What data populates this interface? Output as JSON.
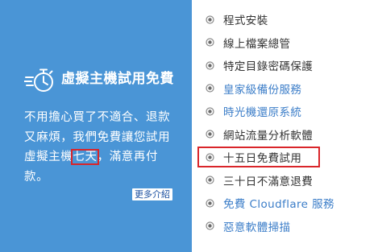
{
  "promo": {
    "title": "虛擬主機試用免費",
    "desc_before": "不用擔心買了不適合、退款又麻煩，我們免費讓您試用虛擬主機",
    "desc_highlight": "七天",
    "desc_after": "，滿意再付款。",
    "more_label": "更多介紹",
    "icon": "stopwatch-icon",
    "highlight_color": "#d9252a",
    "background_color": "#4a95d6"
  },
  "features": {
    "items": [
      {
        "label": "程式安裝",
        "link": false
      },
      {
        "label": "線上檔案總管",
        "link": false
      },
      {
        "label": "特定目錄密碼保護",
        "link": false
      },
      {
        "label": "皇家級備份服務",
        "link": true
      },
      {
        "label": "時光機還原系統",
        "link": true
      },
      {
        "label": "網站流量分析軟體",
        "link": false
      },
      {
        "label": "十五日免費試用",
        "link": false,
        "highlighted": true
      },
      {
        "label": "三十日不滿意退費",
        "link": false
      },
      {
        "label": "免費 Cloudflare 服務",
        "link": true
      },
      {
        "label": "惡意軟體掃描",
        "link": true
      }
    ],
    "bullet_icon": "radio-bullet-icon",
    "link_color": "#3b7dc8",
    "text_color": "#333333"
  }
}
